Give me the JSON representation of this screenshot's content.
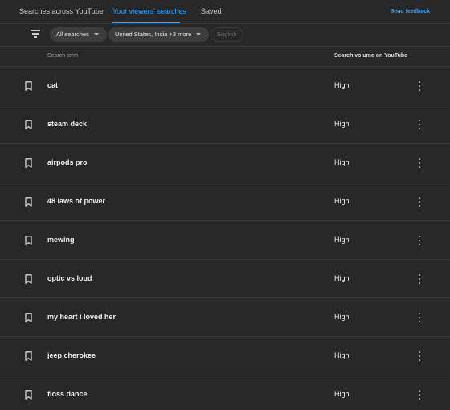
{
  "tabs": [
    {
      "label": "Searches across YouTube"
    },
    {
      "label": "Your viewers' searches"
    },
    {
      "label": "Saved"
    }
  ],
  "feedback_label": "Send feedback",
  "filters": {
    "type": "All searches",
    "region": "United States, India +3 more",
    "language": "English"
  },
  "table": {
    "col_term": "Search term",
    "col_volume": "Search volume on YouTube"
  },
  "rows": [
    {
      "term": "cat",
      "volume": "High"
    },
    {
      "term": "steam deck",
      "volume": "High"
    },
    {
      "term": "airpods pro",
      "volume": "High"
    },
    {
      "term": "48 laws of power",
      "volume": "High"
    },
    {
      "term": "mewing",
      "volume": "High"
    },
    {
      "term": "optic vs loud",
      "volume": "High"
    },
    {
      "term": "my heart i loved her",
      "volume": "High"
    },
    {
      "term": "jeep cherokee",
      "volume": "High"
    },
    {
      "term": "floss dance",
      "volume": "High"
    }
  ],
  "icons": {
    "filter": "filter-icon",
    "bookmark": "bookmark-icon",
    "more": "more-vert-icon",
    "caret": "caret-down-icon"
  },
  "colors": {
    "background": "#282828",
    "accent": "#3ea6ff",
    "divider": "#3a3a3a",
    "chip": "#3d3d3d"
  }
}
